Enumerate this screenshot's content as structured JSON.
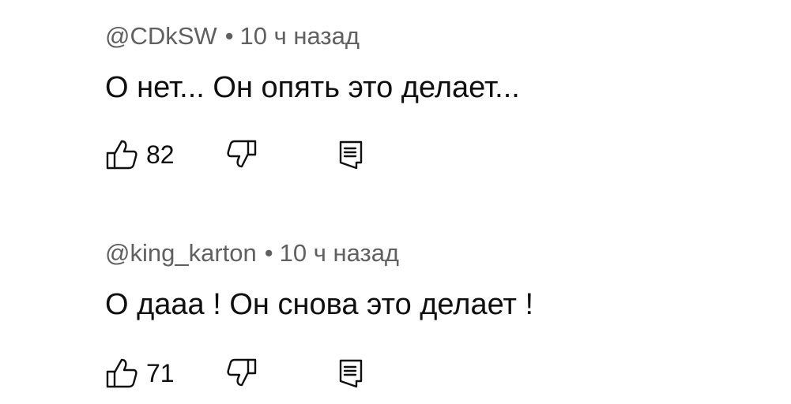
{
  "comments": [
    {
      "author": "@CDkSW",
      "separator": "•",
      "time": "10 ч назад",
      "text": "О нет... Он опять это делает...",
      "likes": "82",
      "icons": {
        "like": "thumbs-up-icon",
        "dislike": "thumbs-down-icon",
        "reply": "reply-comment-icon"
      }
    },
    {
      "author": "@king_karton",
      "separator": "•",
      "time": "10 ч назад",
      "text": "О дааа ! Он снова это делает !",
      "likes": "71",
      "icons": {
        "like": "thumbs-up-icon",
        "dislike": "thumbs-down-icon",
        "reply": "reply-comment-icon"
      }
    }
  ],
  "colors": {
    "text": "#0f0f0f",
    "meta": "#606060",
    "background": "#ffffff"
  }
}
